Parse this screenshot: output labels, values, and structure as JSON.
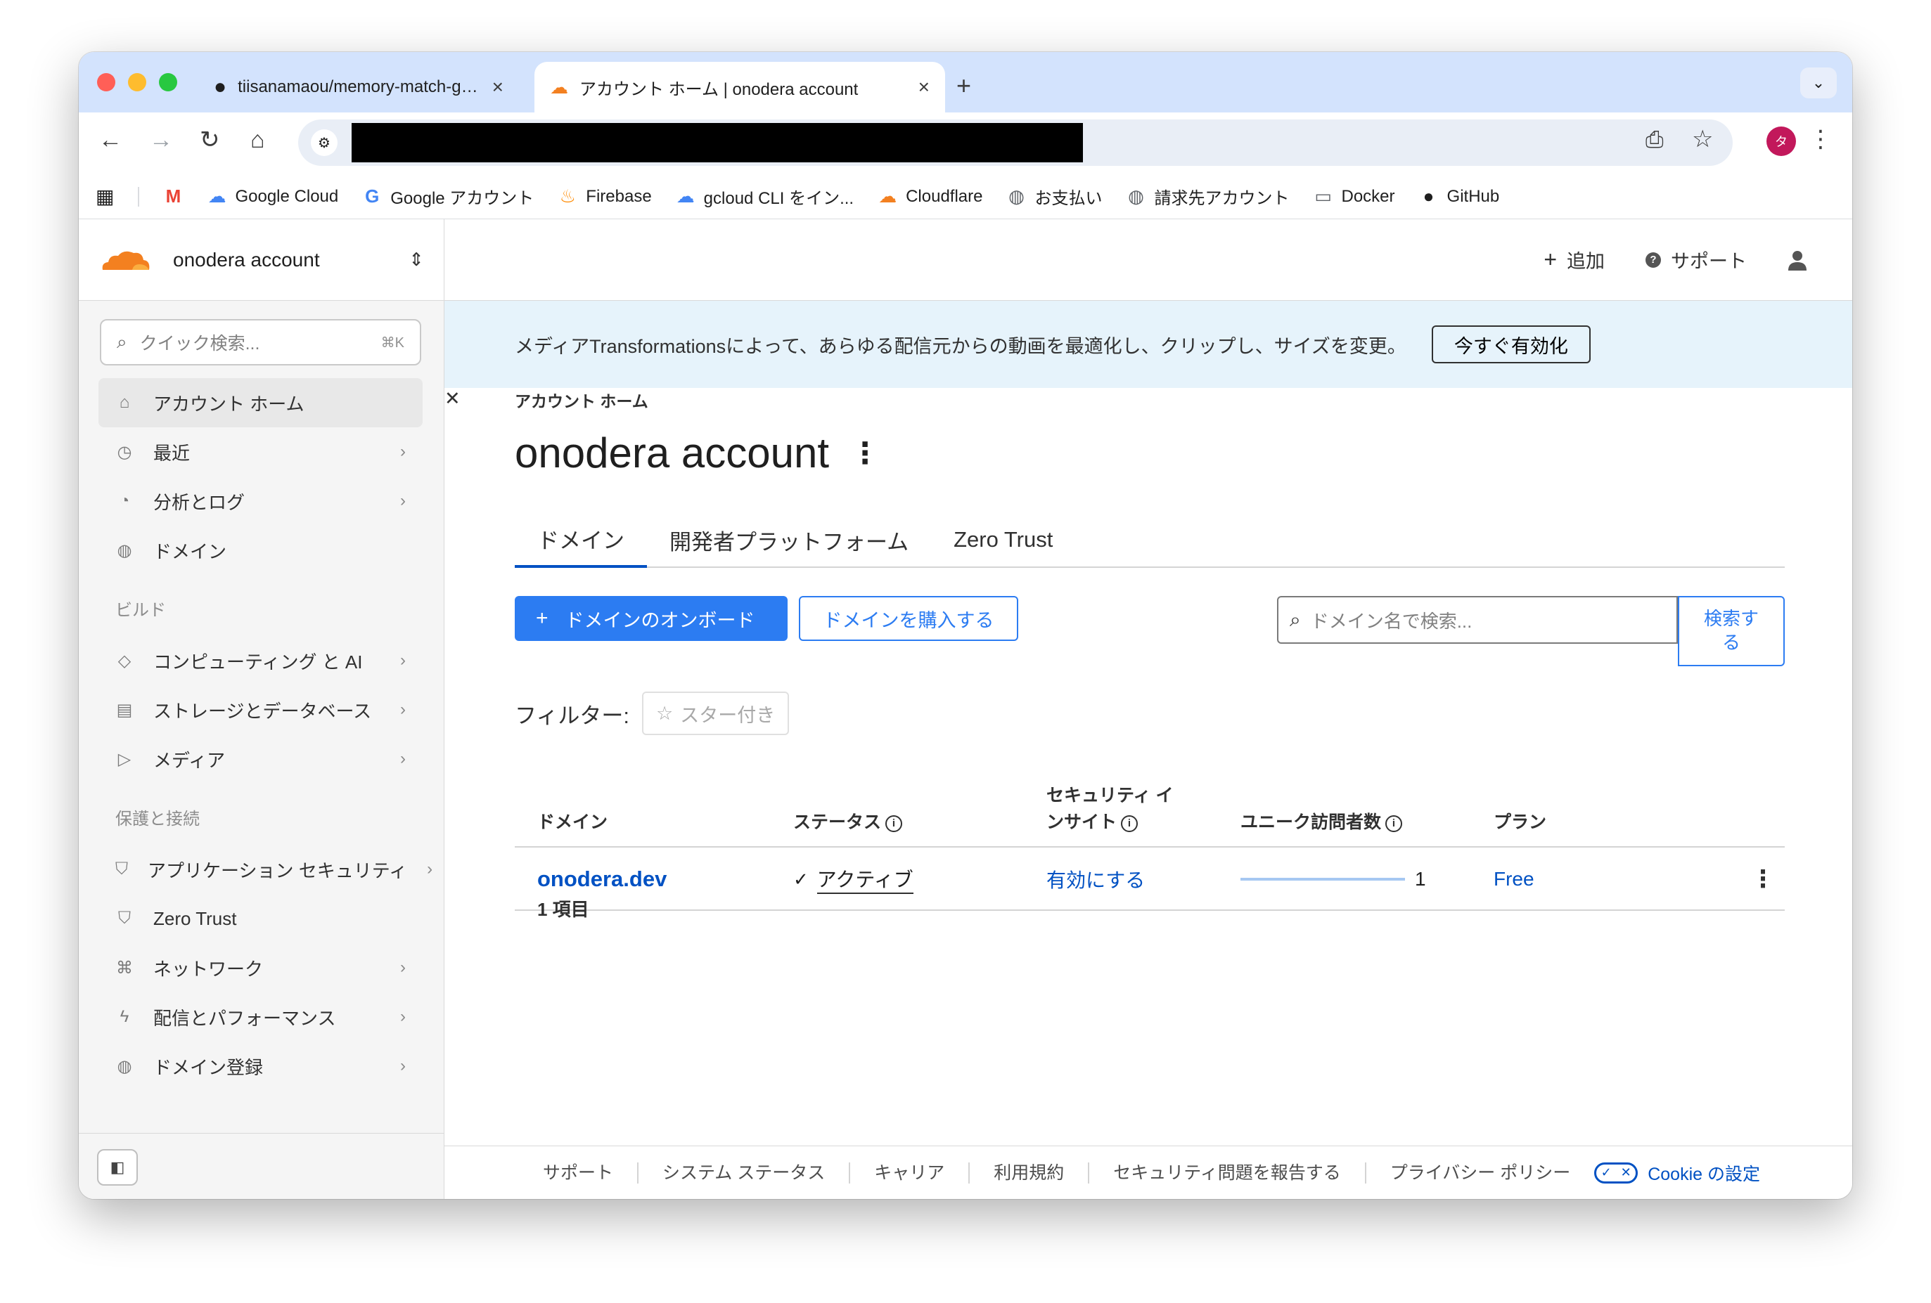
{
  "browser": {
    "tabs": [
      {
        "title": "tiisanamaou/memory-match-game"
      },
      {
        "title": "アカウント ホーム | onodera account"
      }
    ],
    "avatar_initial": "タ",
    "bookmarks": [
      {
        "label": "",
        "icon": "gmail-icon"
      },
      {
        "label": "Google Cloud",
        "icon": "google-cloud-icon"
      },
      {
        "label": "Google アカウント",
        "icon": "google-icon"
      },
      {
        "label": "Firebase",
        "icon": "firebase-icon"
      },
      {
        "label": "gcloud CLI をイン...",
        "icon": "google-cloud-icon"
      },
      {
        "label": "Cloudflare",
        "icon": "cloudflare-icon"
      },
      {
        "label": "お支払い",
        "icon": "globe-icon"
      },
      {
        "label": "請求先アカウント",
        "icon": "globe-icon"
      },
      {
        "label": "Docker",
        "icon": "folder-icon"
      },
      {
        "label": "GitHub",
        "icon": "github-icon"
      }
    ]
  },
  "sidebar": {
    "account_name": "onodera account",
    "search_placeholder": "クイック検索...",
    "search_shortcut": "⌘K",
    "items": [
      {
        "label": "アカウント ホーム",
        "icon": "home-icon",
        "chevron": false,
        "active": true
      },
      {
        "label": "最近",
        "icon": "clock-icon",
        "chevron": true
      },
      {
        "label": "分析とログ",
        "icon": "pie-chart-icon",
        "chevron": true
      },
      {
        "label": "ドメイン",
        "icon": "globe-icon",
        "chevron": false
      }
    ],
    "section_build": "ビルド",
    "build_items": [
      {
        "label": "コンピューティング と AI",
        "icon": "diamond-icon",
        "chevron": true
      },
      {
        "label": "ストレージとデータベース",
        "icon": "database-icon",
        "chevron": true
      },
      {
        "label": "メディア",
        "icon": "play-icon",
        "chevron": true
      }
    ],
    "section_protect": "保護と接続",
    "protect_items": [
      {
        "label": "アプリケーション セキュリティ",
        "icon": "shield-icon",
        "chevron": true
      },
      {
        "label": "Zero Trust",
        "icon": "shield-check-icon",
        "chevron": false
      },
      {
        "label": "ネットワーク",
        "icon": "network-icon",
        "chevron": true
      },
      {
        "label": "配信とパフォーマンス",
        "icon": "bolt-icon",
        "chevron": true
      },
      {
        "label": "ドメイン登録",
        "icon": "globe-icon",
        "chevron": true
      }
    ]
  },
  "topbar": {
    "add_label": "追加",
    "support_label": "サポート"
  },
  "banner": {
    "text": "メディアTransformationsによって、あらゆる配信元からの動画を最適化し、クリップし、サイズを変更。",
    "cta": "今すぐ有効化"
  },
  "page": {
    "breadcrumb": "アカウント ホーム",
    "title": "onodera account",
    "tabs": [
      "ドメイン",
      "開発者プラットフォーム",
      "Zero Trust"
    ],
    "onboard_button": "ドメインのオンボード",
    "buy_button": "ドメインを購入する",
    "search_placeholder": "ドメイン名で検索...",
    "search_button": "検索する",
    "filter_label": "フィルター:",
    "filter_chip": "スター付き",
    "table": {
      "headers": {
        "domain": "ドメイン",
        "status": "ステータス",
        "security_line1": "セキュリティ イ",
        "security_line2": "ンサイト",
        "visitors": "ユニーク訪問者数",
        "plan": "プラン"
      },
      "rows": [
        {
          "domain": "onodera.dev",
          "status": "アクティブ",
          "security": "有効にする",
          "visitors": "1",
          "plan": "Free"
        }
      ]
    },
    "item_count": "1 項目"
  },
  "footer": {
    "links": [
      "サポート",
      "システム ステータス",
      "キャリア",
      "利用規約",
      "セキュリティ問題を報告する",
      "プライバシー ポリシー"
    ],
    "cookie": "Cookie の設定"
  },
  "colors": {
    "accent": "#0051c3",
    "primary_button": "#2c7cf2",
    "banner_bg": "#e6f3fb",
    "tabstrip": "#d3e3fd",
    "cloudflare_orange": "#f38020"
  }
}
